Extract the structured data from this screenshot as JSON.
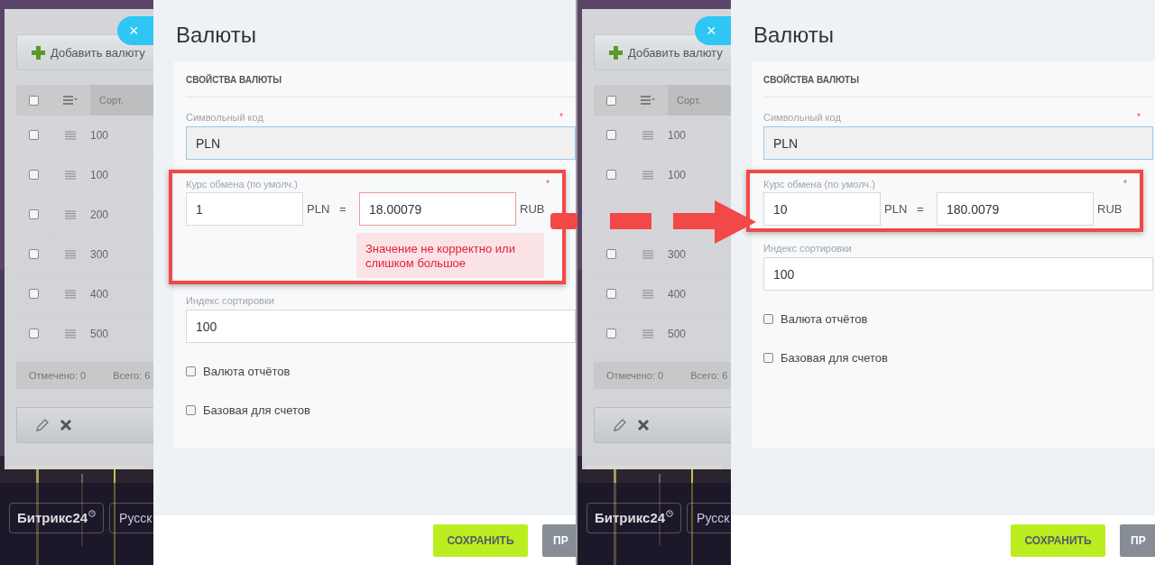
{
  "panels": [
    {
      "list": {
        "add_button": "Добавить валюту",
        "header": {
          "checked": false,
          "column_3": "Сорт."
        },
        "rows": [
          {
            "checked": false,
            "sort": "100"
          },
          {
            "checked": false,
            "sort": "100"
          },
          {
            "checked": false,
            "sort": "200"
          },
          {
            "checked": false,
            "sort": "300"
          },
          {
            "checked": false,
            "sort": "400"
          },
          {
            "checked": false,
            "sort": "500"
          }
        ],
        "footer": {
          "marked": "Отмечено: 0",
          "total": "Всего: 6"
        }
      },
      "logo": "Битрикс24",
      "language_button": "Русск",
      "close_button": "×",
      "slider": {
        "title": "Валюты",
        "section_title": "СВОЙСТВА ВАЛЮТЫ",
        "symbol_code": {
          "label": "Символьный код",
          "required_mark": "*",
          "value": "PLN"
        },
        "rate": {
          "highlighted": true,
          "label": "Курс обмена (по умолч.)",
          "required_mark": "*",
          "amount": "1",
          "currency": "PLN",
          "equals": "=",
          "rate": "18.00079",
          "invalid": true,
          "base_currency": "RUB",
          "error": "Значение не корректно или слишком большое"
        },
        "sort_index": {
          "label": "Индекс сортировки",
          "value": "100"
        },
        "checkboxes": [
          {
            "label": "Валюта отчётов",
            "checked": false
          },
          {
            "label": "Базовая для счетов",
            "checked": false
          }
        ],
        "save_button": "СОХРАНИТЬ",
        "apply_button": "ПР"
      }
    },
    {
      "list": {
        "add_button": "Добавить валюту",
        "header": {
          "checked": false,
          "column_3": "Сорт."
        },
        "rows": [
          {
            "checked": false,
            "sort": "100"
          },
          {
            "checked": false,
            "sort": "100"
          },
          {},
          {
            "checked": false,
            "sort": "300"
          },
          {
            "checked": false,
            "sort": "400"
          },
          {
            "checked": false,
            "sort": "500"
          }
        ],
        "footer": {
          "marked": "Отмечено: 0",
          "total": "Всего: 6"
        }
      },
      "logo": "Битрикс24",
      "language_button": "Русск",
      "close_button": "×",
      "slider": {
        "title": "Валюты",
        "section_title": "СВОЙСТВА ВАЛЮТЫ",
        "symbol_code": {
          "label": "Символьный код",
          "required_mark": "*",
          "value": "PLN"
        },
        "rate": {
          "highlighted": true,
          "label": "Курс обмена (по умолч.)",
          "required_mark": "*",
          "amount": "10",
          "currency": "PLN",
          "equals": "=",
          "rate": "180.0079",
          "invalid": false,
          "base_currency": "RUB"
        },
        "sort_index": {
          "label": "Индекс сортировки",
          "value": "100"
        },
        "checkboxes": [
          {
            "label": "Валюта отчётов",
            "checked": false
          },
          {
            "label": "Базовая для счетов",
            "checked": false
          }
        ],
        "save_button": "СОХРАНИТЬ",
        "apply_button": "ПР"
      }
    }
  ]
}
